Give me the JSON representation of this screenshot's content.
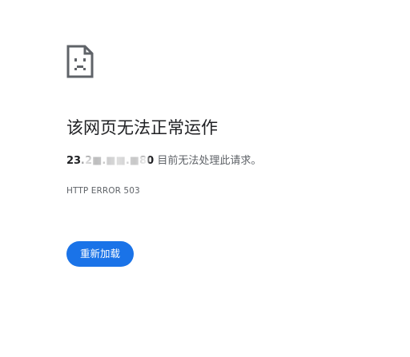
{
  "error_page": {
    "icon": "sad-page-icon",
    "title": "该网页无法正常运作",
    "host": "23.2■.■■.■80",
    "message_suffix": " 目前无法处理此请求。",
    "error_code": "HTTP ERROR 503",
    "reload_label": "重新加载"
  },
  "colors": {
    "accent": "#1a73e8",
    "title_text": "#202124",
    "secondary_text": "#5f6368",
    "icon": "#5f6368"
  }
}
